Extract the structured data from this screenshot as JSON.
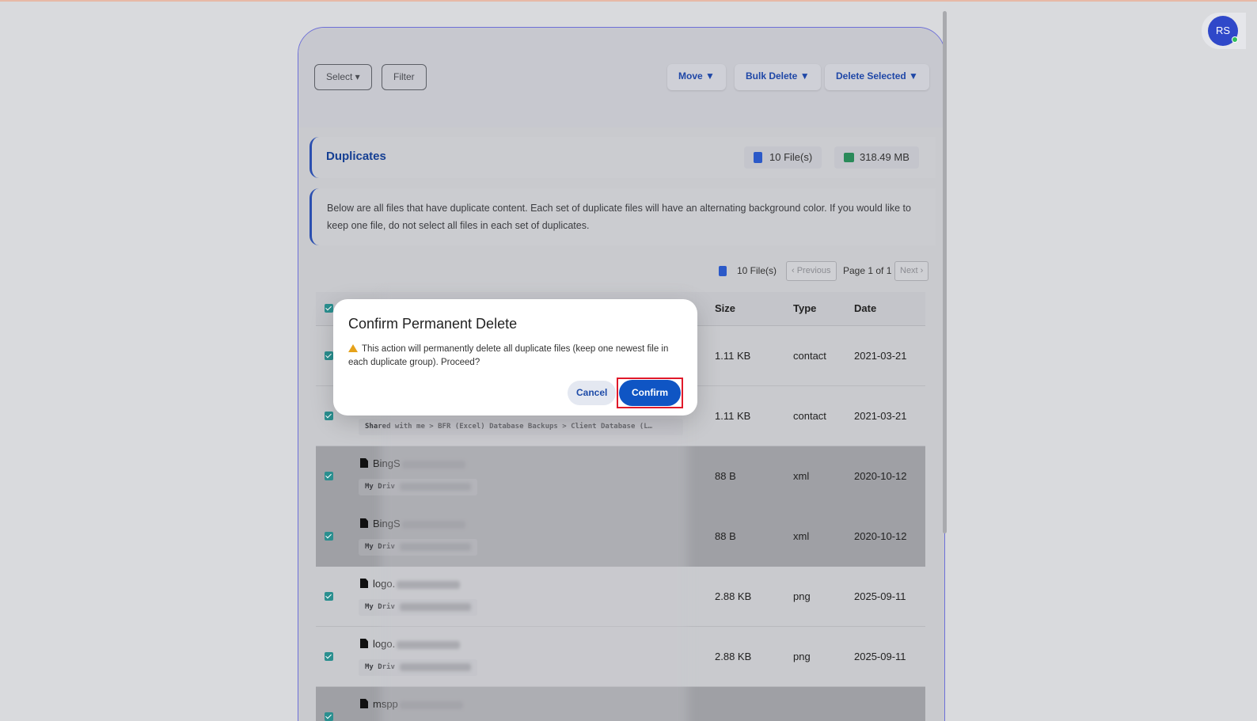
{
  "toolbar": {
    "select_label": "Select ▾",
    "filter_label": "Filter",
    "move_label": "Move ▼",
    "bulk_delete_label": "Bulk Delete ▼",
    "delete_selected_label": "Delete Selected ▼"
  },
  "section": {
    "title": "Duplicates",
    "files_count": "10 File(s)",
    "total_size": "318.49 MB",
    "description": "Below are all files that have duplicate content. Each set of duplicate files will have an alternating background color. If you would like to keep one file, do not select all files in each set of duplicates."
  },
  "pager": {
    "files_count": "10 File(s)",
    "previous_label": "‹ Previous",
    "page_text": "Page 1 of 1",
    "next_label": "Next ›"
  },
  "table": {
    "headers": [
      "Size",
      "Type",
      "Date"
    ],
    "rows": [
      {
        "name": "",
        "path": "",
        "size": "1.11 KB",
        "type": "contact",
        "date": "2021-03-21",
        "alt": false
      },
      {
        "name": "",
        "path": "Shared with me > BFR (Excel) Database Backups > Client Database (L…",
        "size": "1.11 KB",
        "type": "contact",
        "date": "2021-03-21",
        "alt": false
      },
      {
        "name": "BingS",
        "path": "My Driv",
        "size": "88 B",
        "type": "xml",
        "date": "2020-10-12",
        "alt": true
      },
      {
        "name": "BingS",
        "path": "My Driv",
        "size": "88 B",
        "type": "xml",
        "date": "2020-10-12",
        "alt": true
      },
      {
        "name": "logo.",
        "path": "My Driv",
        "size": "2.88 KB",
        "type": "png",
        "date": "2025-09-11",
        "alt": false
      },
      {
        "name": "logo.",
        "path": "My Driv",
        "size": "2.88 KB",
        "type": "png",
        "date": "2025-09-11",
        "alt": false
      },
      {
        "name": "mspp",
        "path": "",
        "size": "",
        "type": "",
        "date": "",
        "alt": true
      }
    ]
  },
  "user": {
    "initials": "RS"
  },
  "modal": {
    "title": "Confirm Permanent Delete",
    "message": "This action will permanently delete all duplicate files (keep one newest file in each duplicate group). Proceed?",
    "cancel_label": "Cancel",
    "confirm_label": "Confirm"
  },
  "colors": {
    "accent": "#0f55c4",
    "highlight": "#e0192a",
    "section_border": "#2b4fb0",
    "avatar": "#2f48c9"
  }
}
